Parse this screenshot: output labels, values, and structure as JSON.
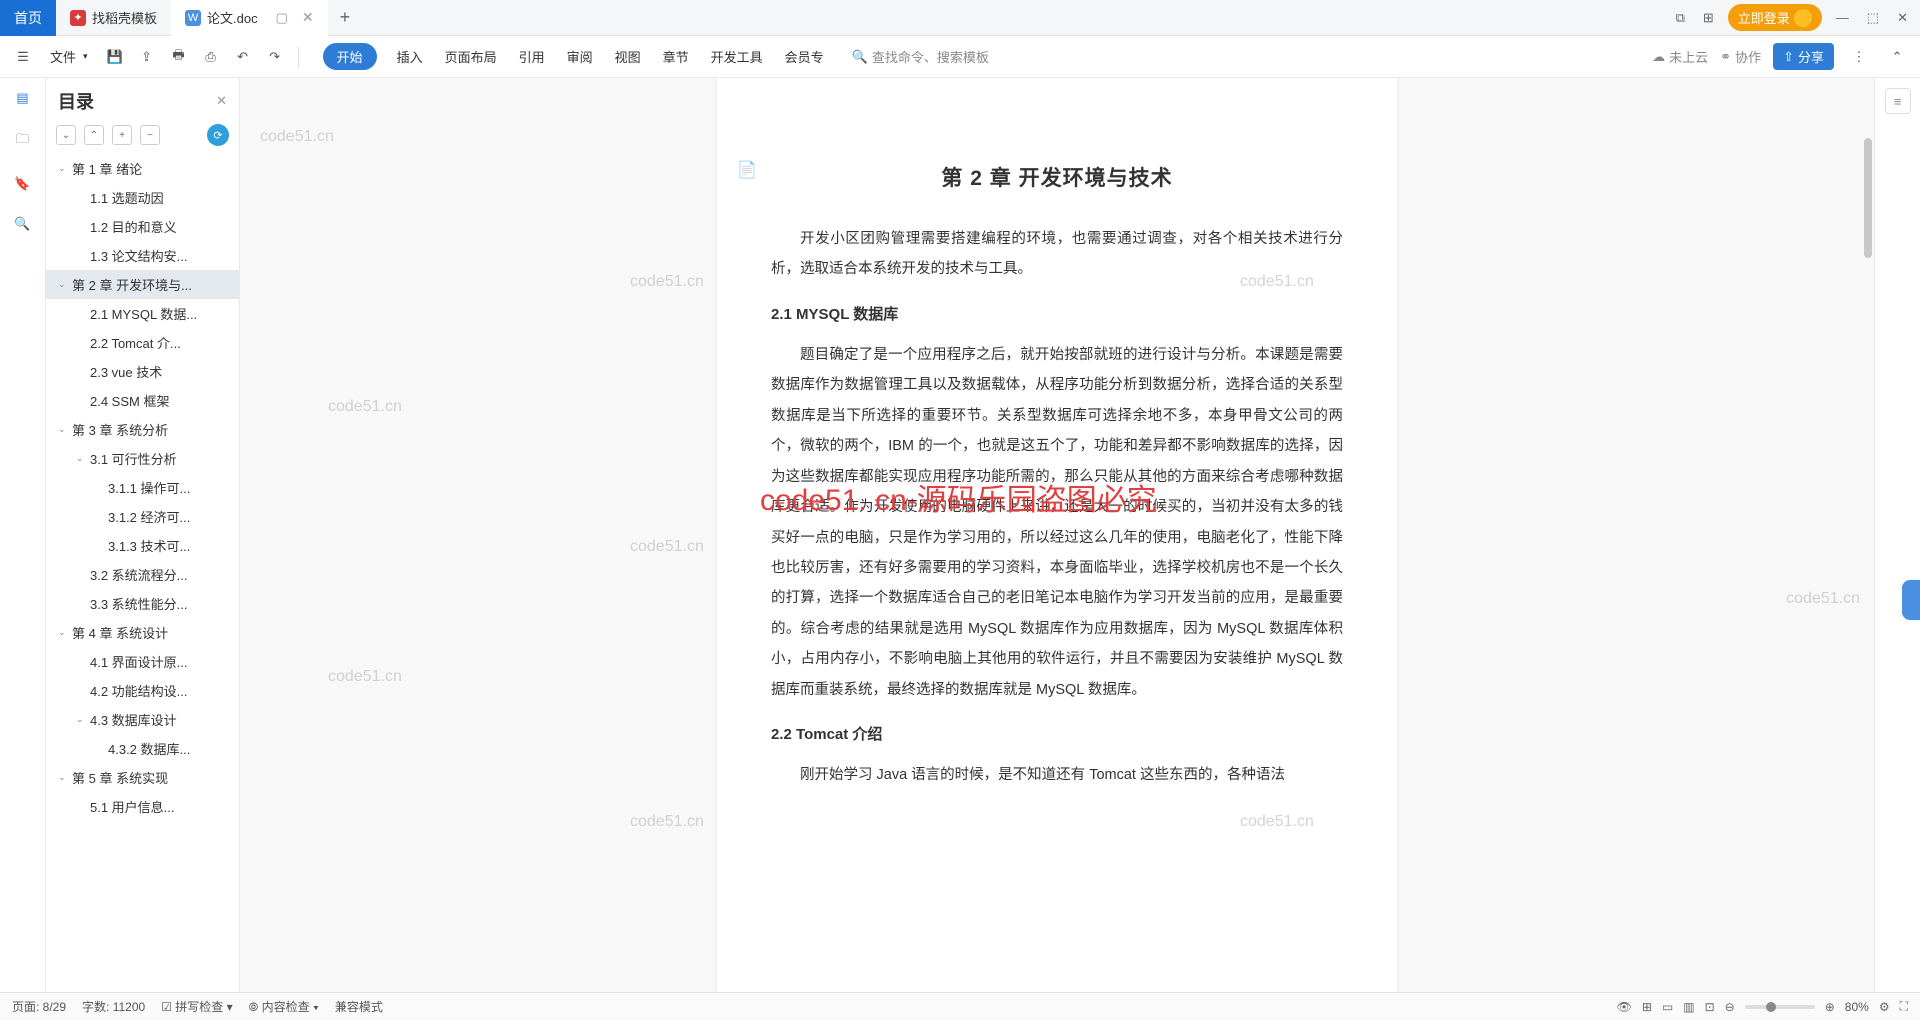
{
  "tabs": {
    "home": "首页",
    "template": "找稻壳模板",
    "doc": "论文.doc"
  },
  "login": "立即登录",
  "toolbar": {
    "file": "文件",
    "menus": [
      "开始",
      "插入",
      "页面布局",
      "引用",
      "审阅",
      "视图",
      "章节",
      "开发工具",
      "会员专"
    ],
    "search_ph": "查找命令、搜索模板",
    "cloud": "未上云",
    "collab": "协作",
    "share": "分享"
  },
  "sidebar": {
    "title": "目录",
    "items": [
      {
        "t": "第 1 章  绪论",
        "lv": 0,
        "c": 1
      },
      {
        "t": "1.1 选题动因",
        "lv": 1
      },
      {
        "t": "1.2 目的和意义",
        "lv": 1
      },
      {
        "t": "1.3 论文结构安...",
        "lv": 1
      },
      {
        "t": "第 2 章  开发环境与...",
        "lv": 0,
        "c": 1,
        "sel": 1
      },
      {
        "t": "2.1 MYSQL 数据...",
        "lv": 1
      },
      {
        "t": "2.2 Tomcat  介...",
        "lv": 1
      },
      {
        "t": "2.3 vue 技术",
        "lv": 1
      },
      {
        "t": "2.4 SSM 框架",
        "lv": 1
      },
      {
        "t": "第 3 章  系统分析",
        "lv": 0,
        "c": 1
      },
      {
        "t": "3.1 可行性分析",
        "lv": 1,
        "c": 1
      },
      {
        "t": "3.1.1 操作可...",
        "lv": 2
      },
      {
        "t": "3.1.2 经济可...",
        "lv": 2
      },
      {
        "t": "3.1.3 技术可...",
        "lv": 2
      },
      {
        "t": "3.2 系统流程分...",
        "lv": 1
      },
      {
        "t": "3.3 系统性能分...",
        "lv": 1
      },
      {
        "t": "第 4 章  系统设计",
        "lv": 0,
        "c": 1
      },
      {
        "t": "4.1 界面设计原...",
        "lv": 1
      },
      {
        "t": "4.2 功能结构设...",
        "lv": 1
      },
      {
        "t": "4.3 数据库设计",
        "lv": 1,
        "c": 1
      },
      {
        "t": "4.3.2  数据库...",
        "lv": 2
      },
      {
        "t": "第 5 章  系统实现",
        "lv": 0,
        "c": 1
      },
      {
        "t": "5.1 用户信息...",
        "lv": 1
      }
    ]
  },
  "doc": {
    "h1": "第 2 章  开发环境与技术",
    "p1": "开发小区团购管理需要搭建编程的环境，也需要通过调查，对各个相关技术进行分析，选取适合本系统开发的技术与工具。",
    "h2a": "2.1 MYSQL 数据库",
    "p2": "题目确定了是一个应用程序之后，就开始按部就班的进行设计与分析。本课题是需要数据库作为数据管理工具以及数据载体，从程序功能分析到数据分析，选择合适的关系型数据库是当下所选择的重要环节。关系型数据库可选择余地不多，本身甲骨文公司的两个，微软的两个，IBM 的一个，也就是这五个了，功能和差异都不影响数据库的选择，因为这些数据库都能实现应用程序功能所需的，那么只能从其他的方面来综合考虑哪种数据库更合适。作为开发使用的电脑硬件上来讲，还是大一的时候买的，当初并没有太多的钱买好一点的电脑，只是作为学习用的，所以经过这么几年的使用，电脑老化了，性能下降也比较厉害，还有好多需要用的学习资料，本身面临毕业，选择学校机房也不是一个长久的打算，选择一个数据库适合自己的老旧笔记本电脑作为学习开发当前的应用，是最重要的。综合考虑的结果就是选用 MySQL 数据库作为应用数据库，因为 MySQL 数据库体积小，占用内存小，不影响电脑上其他用的软件运行，并且不需要因为安装维护 MySQL 数据库而重装系统，最终选择的数据库就是 MySQL 数据库。",
    "h2b": "2.2 Tomcat  介绍",
    "p3": "刚开始学习 Java 语言的时候，是不知道还有 Tomcat 这些东西的，各种语法"
  },
  "watermarks": {
    "text": "code51.cn",
    "red": "code51. cn-源码乐园盗图必究"
  },
  "status": {
    "page": "页面: 8/29",
    "words": "字数: 11200",
    "spell": "拼写检查",
    "content": "内容检查",
    "compat": "兼容模式",
    "zoom": "80%"
  }
}
